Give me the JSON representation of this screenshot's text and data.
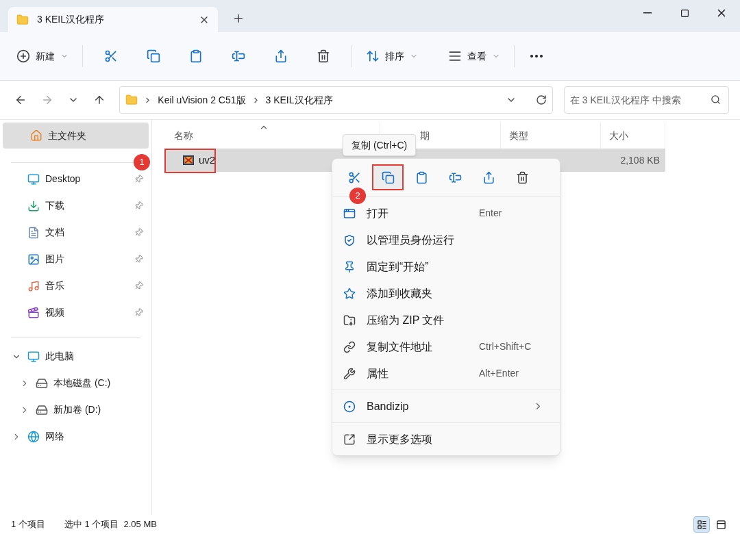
{
  "window": {
    "tab_title": "3 KEIL汉化程序"
  },
  "toolbar": {
    "new": "新建",
    "sort": "排序",
    "view": "查看"
  },
  "address": {
    "crumbs": [
      "Keil uVision 2 C51版",
      "3 KEIL汉化程序"
    ],
    "search_placeholder": "在 3 KEIL汉化程序 中搜索"
  },
  "sidebar": {
    "home": {
      "label": "主文件夹",
      "selected": true
    },
    "quick_access": [
      {
        "label": "Desktop",
        "pinned": true
      },
      {
        "label": "下载",
        "pinned": true
      },
      {
        "label": "文档",
        "pinned": true
      },
      {
        "label": "图片",
        "pinned": true
      },
      {
        "label": "音乐",
        "pinned": true
      },
      {
        "label": "视频",
        "pinned": true
      }
    ],
    "tree": [
      {
        "label": "此电脑",
        "expanded": true,
        "children": [
          {
            "label": "本地磁盘 (C:)",
            "expanded": false
          },
          {
            "label": "新加卷 (D:)",
            "expanded": false
          }
        ]
      },
      {
        "label": "网络",
        "expanded": false
      }
    ]
  },
  "table": {
    "columns": [
      "名称",
      "期",
      "类型",
      "大小"
    ],
    "rows": [
      {
        "name": "uv2",
        "size": "2,108 KB",
        "selected": true
      }
    ]
  },
  "tooltip": "复制 (Ctrl+C)",
  "context_menu": {
    "sections": [
      [
        {
          "label": "打开",
          "shortcut": "Enter"
        },
        {
          "label": "以管理员身份运行"
        },
        {
          "label": "固定到“开始”"
        },
        {
          "label": "添加到收藏夹"
        },
        {
          "label": "压缩为 ZIP 文件"
        },
        {
          "label": "复制文件地址",
          "shortcut": "Ctrl+Shift+C"
        },
        {
          "label": "属性",
          "shortcut": "Alt+Enter"
        }
      ],
      [
        {
          "label": "Bandizip",
          "submenu": true
        }
      ],
      [
        {
          "label": "显示更多选项"
        }
      ]
    ]
  },
  "callouts": [
    "1",
    "2"
  ],
  "status_bar": {
    "count": "1 个项目",
    "selection": "选中 1 个项目  2.05 MB"
  }
}
